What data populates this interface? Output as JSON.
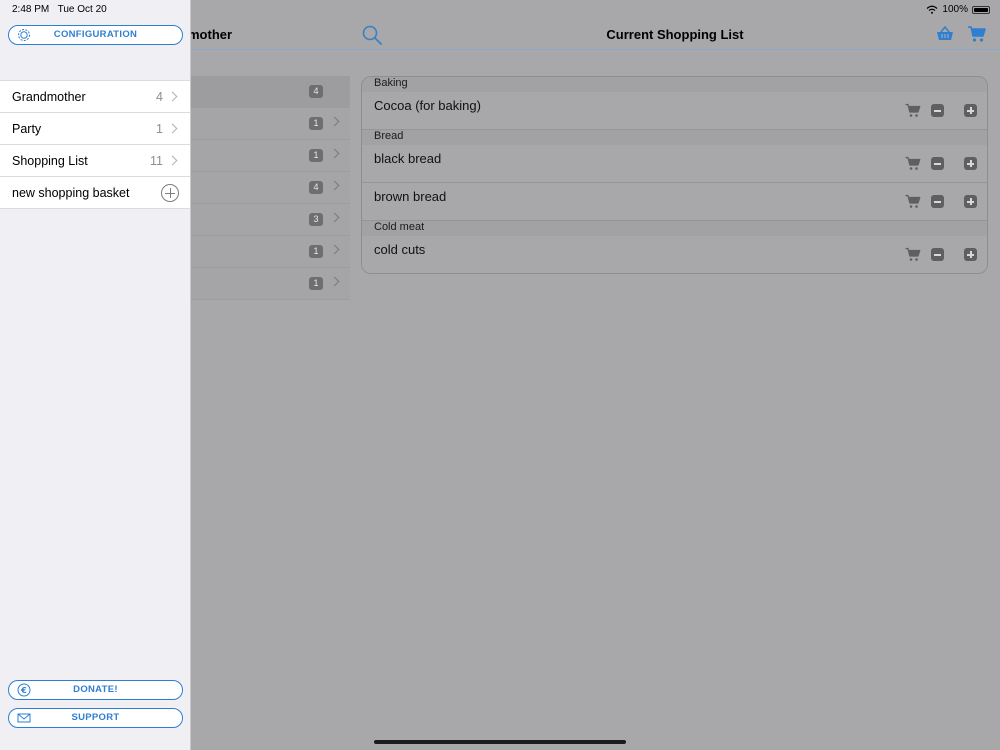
{
  "status_bar": {
    "time": "2:48 PM",
    "date": "Tue Oct 20",
    "battery": "100%",
    "icons": [
      "wifi-icon",
      "battery-icon"
    ]
  },
  "background_app": {
    "left_title": "mother",
    "main_title": "Current Shopping List",
    "left_badges": [
      "4",
      "1",
      "1",
      "4",
      "3",
      "1",
      "1"
    ],
    "sections": [
      {
        "name": "Baking",
        "items": [
          {
            "name": "Cocoa (for baking)"
          }
        ]
      },
      {
        "name": "Bread",
        "items": [
          {
            "name": "black bread"
          },
          {
            "name": "brown bread"
          }
        ]
      },
      {
        "name": "Cold meat",
        "items": [
          {
            "name": "cold cuts"
          }
        ]
      }
    ],
    "icons": [
      "search-icon",
      "basket-icon",
      "cart-icon",
      "minus-icon",
      "plus-icon"
    ]
  },
  "sidebar": {
    "configuration_label": "CONFIGURATION",
    "lists": [
      {
        "label": "Grandmother",
        "count": "4"
      },
      {
        "label": "Party",
        "count": "1"
      },
      {
        "label": "Shopping List",
        "count": "11"
      }
    ],
    "new_basket_label": "new shopping basket",
    "donate_label": "DONATE!",
    "support_label": "SUPPORT",
    "icons": [
      "gear-icon",
      "euro-icon",
      "mail-icon",
      "chevron-right-icon",
      "add-circle-icon"
    ]
  },
  "colors": {
    "accent": "#2f7fd1",
    "dimmed_background": "#a8a8aa",
    "sidebar_background": "#efeff4"
  }
}
